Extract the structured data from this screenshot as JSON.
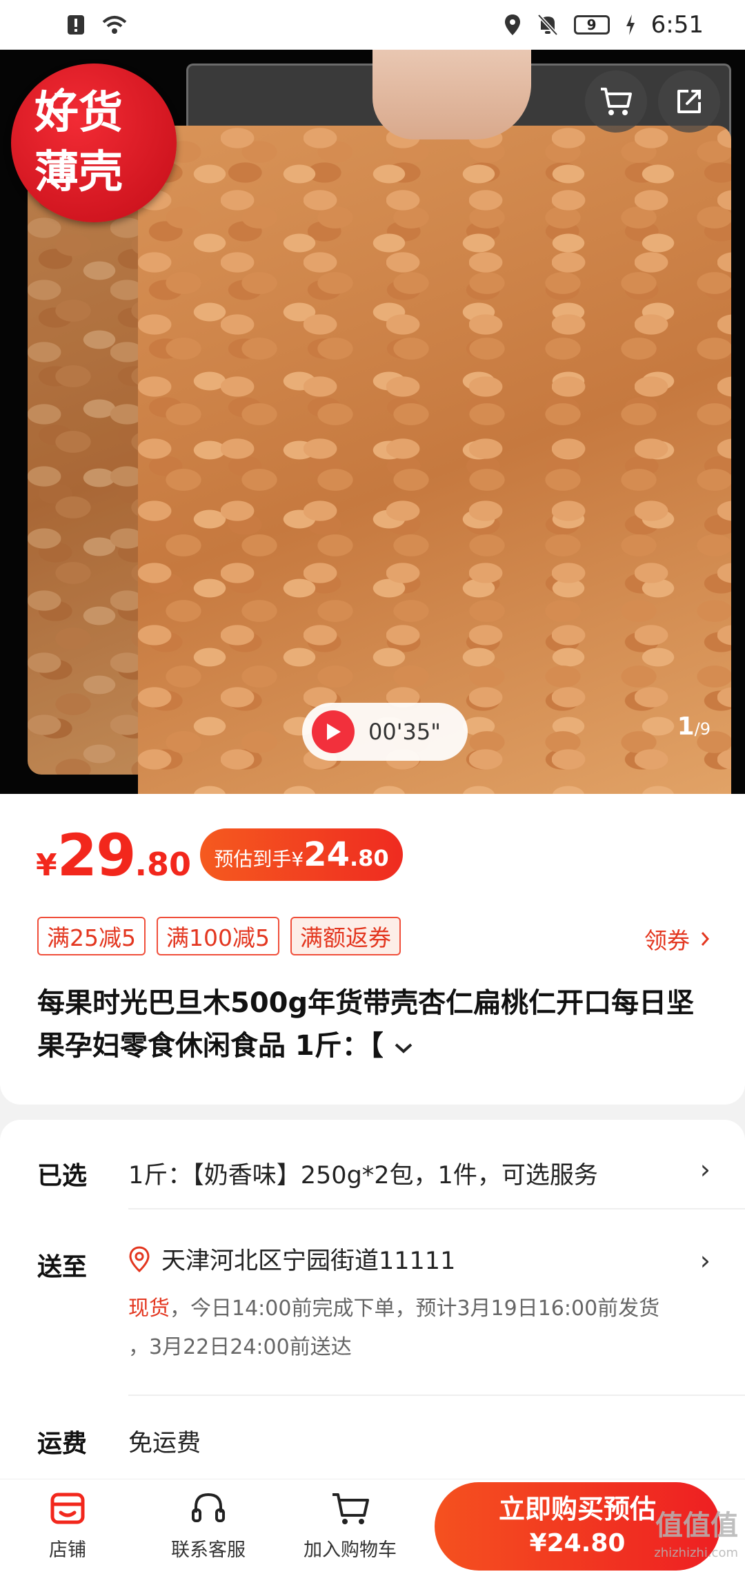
{
  "status_bar": {
    "time": "6:51",
    "battery": "9",
    "icons": [
      "alert-icon",
      "wifi-icon",
      "location-icon",
      "mute-icon",
      "battery-icon",
      "charging-icon"
    ]
  },
  "hero": {
    "badge_line1": "好货",
    "badge_line2": "薄壳",
    "video_time": "00'35\"",
    "pager_current": "1",
    "pager_total": "/9"
  },
  "price": {
    "symbol": "¥",
    "integer": "29",
    "decimal": ".80",
    "estimate_label": "预估到手",
    "estimate_symbol": "¥",
    "estimate_integer": "24",
    "estimate_decimal": ".80"
  },
  "coupons": [
    "满25减5",
    "满100减5",
    "满额返券"
  ],
  "get_coupon_label": "领券",
  "product_title": "每果时光巴旦木500g年货带壳杏仁扁桃仁开口每日坚果孕妇零食休闲食品 1斤：【",
  "spec": {
    "selected_label": "已选",
    "selected_value": "1斤：【奶香味】250g*2包，1件，可选服务",
    "ship_label": "送至",
    "address": "天津河北区宁园街道11111",
    "stock_status": "现货",
    "ship_detail_1": "，今日14:00前完成下单，预计3月19日16:00前发货",
    "ship_detail_2": "，3月22日24:00前送达",
    "freight_label": "运费",
    "freight_value": "免运费"
  },
  "bottom_bar": {
    "store_label": "店铺",
    "service_label": "联系客服",
    "cart_label": "加入购物车",
    "buy_line1": "立即购买预估",
    "buy_line2": "¥24.80"
  },
  "watermark": {
    "text": "值值值",
    "sub": "zhizhizhi.com"
  },
  "colors": {
    "accent": "#f2271c",
    "accent_gradient_start": "#f5511f"
  }
}
